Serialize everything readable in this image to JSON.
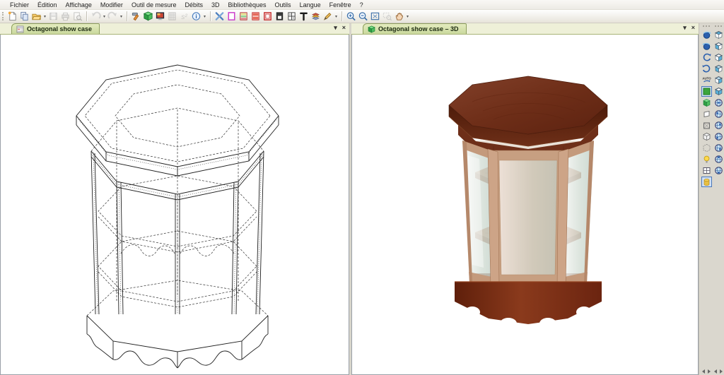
{
  "menubar": {
    "items": [
      "Fichier",
      "Édition",
      "Affichage",
      "Modifier",
      "Outil de mesure",
      "Débits",
      "3D",
      "Bibliothèques",
      "Outils",
      "Langue",
      "Fenêtre",
      "?"
    ]
  },
  "glyphs": {
    "caret": "▾",
    "close": "×",
    "info": "i",
    "s2": "s²",
    "auto": "AUTO"
  },
  "toolbar": {
    "groups": [
      {
        "items": [
          "new-file",
          "copy-project",
          "open-folder",
          "save",
          "print",
          "print-preview"
        ]
      },
      {
        "items": [
          "undo",
          "redo"
        ]
      },
      {
        "items": [
          "properties-hammer",
          "cube-3d",
          "render-monitor",
          "cutting-list",
          "surface-area",
          "info"
        ]
      },
      {
        "items": [
          "tools-cross",
          "frame-outline",
          "panel-multicolor",
          "panel-red",
          "window-red",
          "window-dark",
          "window-grid",
          "tool-t",
          "layers",
          "pencil"
        ]
      },
      {
        "items": [
          "zoom-in",
          "zoom-out",
          "zoom-fit",
          "zoom-window",
          "pan-hand"
        ]
      }
    ]
  },
  "panels": [
    {
      "tab": {
        "icon": "drawing-document-icon",
        "label": "Octagonal show case"
      }
    },
    {
      "tab": {
        "icon": "cube-3d-icon",
        "label": "Octagonal show case – 3D"
      }
    }
  ],
  "sidebar": {
    "left_column": [
      "orbit-left",
      "orbit-right",
      "rotate-cw",
      "rotate-ccw",
      "auto-rotate",
      "view-flat",
      "view-3d",
      "view-board",
      "view-wireframe",
      "view-solid",
      "view-ghost",
      "lighting",
      "multi-view",
      "materials"
    ],
    "left_active": [
      "view-flat",
      "materials"
    ],
    "right_column": [
      "face-top",
      "face-front",
      "face-right",
      "face-left",
      "face-back",
      "face-bottom",
      "iso-view-1",
      "iso-view-2",
      "iso-view-3",
      "iso-view-4",
      "iso-view-5",
      "iso-view-6",
      "iso-view-7"
    ]
  },
  "palette": {
    "tab_strip_bg": "#eef0d8",
    "tab_active_bg": "#cfdda4",
    "tab_border": "#8d9e5d",
    "selection_blue": "#4a77b8",
    "wood_top": "#6e2c16",
    "wood_frame": "#c79f81",
    "wood_shelf": "#a9613c",
    "wood_base": "#7e2d13",
    "glass": "#dfe9e4"
  }
}
